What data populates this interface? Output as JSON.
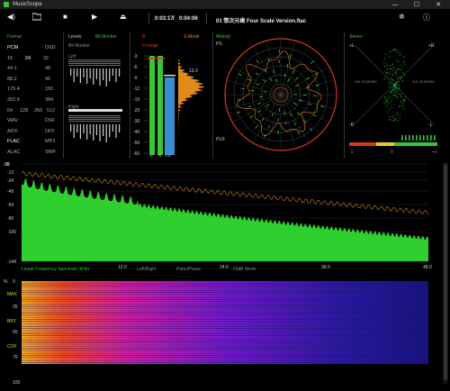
{
  "window": {
    "title": "MusicScope",
    "minimize": "—",
    "maximize": "☐",
    "close": "✕"
  },
  "transport": {
    "volume_icon": "volume-icon",
    "time_elapsed": "0:03:17",
    "time_total": "0:04:06",
    "sep": "/",
    "filename": "01 惣次元歯 Four Scale Version.flac"
  },
  "panels": {
    "format": {
      "title": "Format"
    },
    "levels": {
      "title": "Levels",
      "bit_monitor": "Bit Monitor",
      "left": "Left",
      "right": "Right"
    },
    "meter": {
      "b_label": "B",
      "s_mode": "S-Mode",
      "d_range": "D-range",
      "peak": "13.3"
    },
    "melody": {
      "title": "Melody",
      "pl": "P/L",
      "plr": "PLR"
    },
    "stereo": {
      "title": "Stereo",
      "pos_l": "+L",
      "pos_r": "+R",
      "neg_l": "-L",
      "neg_r": "-R",
      "out_left": "out of phase",
      "out_right": "out of phase",
      "zero": "0",
      "plus1": "+1",
      "minus1": "-1"
    },
    "spectrum": {
      "legend": "Linear Frequency Spectrum (kHz)",
      "mode1": "Left/Right",
      "mode2": "Parts/Phase",
      "mode3": "~20dB Mode"
    },
    "spectrogram": {
      "label_max": "MAX",
      "label_bry": "BRY",
      "label_cof": "COF"
    }
  },
  "format_rows": [
    [
      "PCM",
      "DSD"
    ],
    [
      "16",
      "24",
      "32"
    ],
    [
      "44.1",
      "48"
    ],
    [
      "88.2",
      "96"
    ],
    [
      "176.4",
      "192"
    ],
    [
      "352.8",
      "384"
    ],
    [
      "64",
      "128",
      "256",
      "512"
    ],
    [
      "WAV",
      "DSF"
    ],
    [
      "AIFF",
      "DFF"
    ],
    [
      "FLAC",
      "MP3"
    ],
    [
      "ALAC",
      "SWF"
    ]
  ],
  "meter_ticks": [
    "-3",
    "-6",
    "-9",
    "-12",
    "-15",
    "-20",
    "-30",
    "-40",
    "-50",
    "-60"
  ],
  "meter_foot": [
    "L",
    "R",
    "LU"
  ],
  "spectrum_y": [
    "dB",
    "0",
    "-12",
    "-24",
    "-40",
    "-60",
    "-80",
    "-100",
    "-144"
  ],
  "spectrum_x": [
    "12.0",
    "24.0",
    "36.0",
    "48.0"
  ],
  "spectrogram_y": [
    "%",
    "0",
    "25",
    "50",
    "75",
    "100"
  ],
  "colors": {
    "green": "#35c735",
    "orange": "#e08a1a",
    "red": "#d43a1a",
    "blue": "#3a8fd0"
  }
}
